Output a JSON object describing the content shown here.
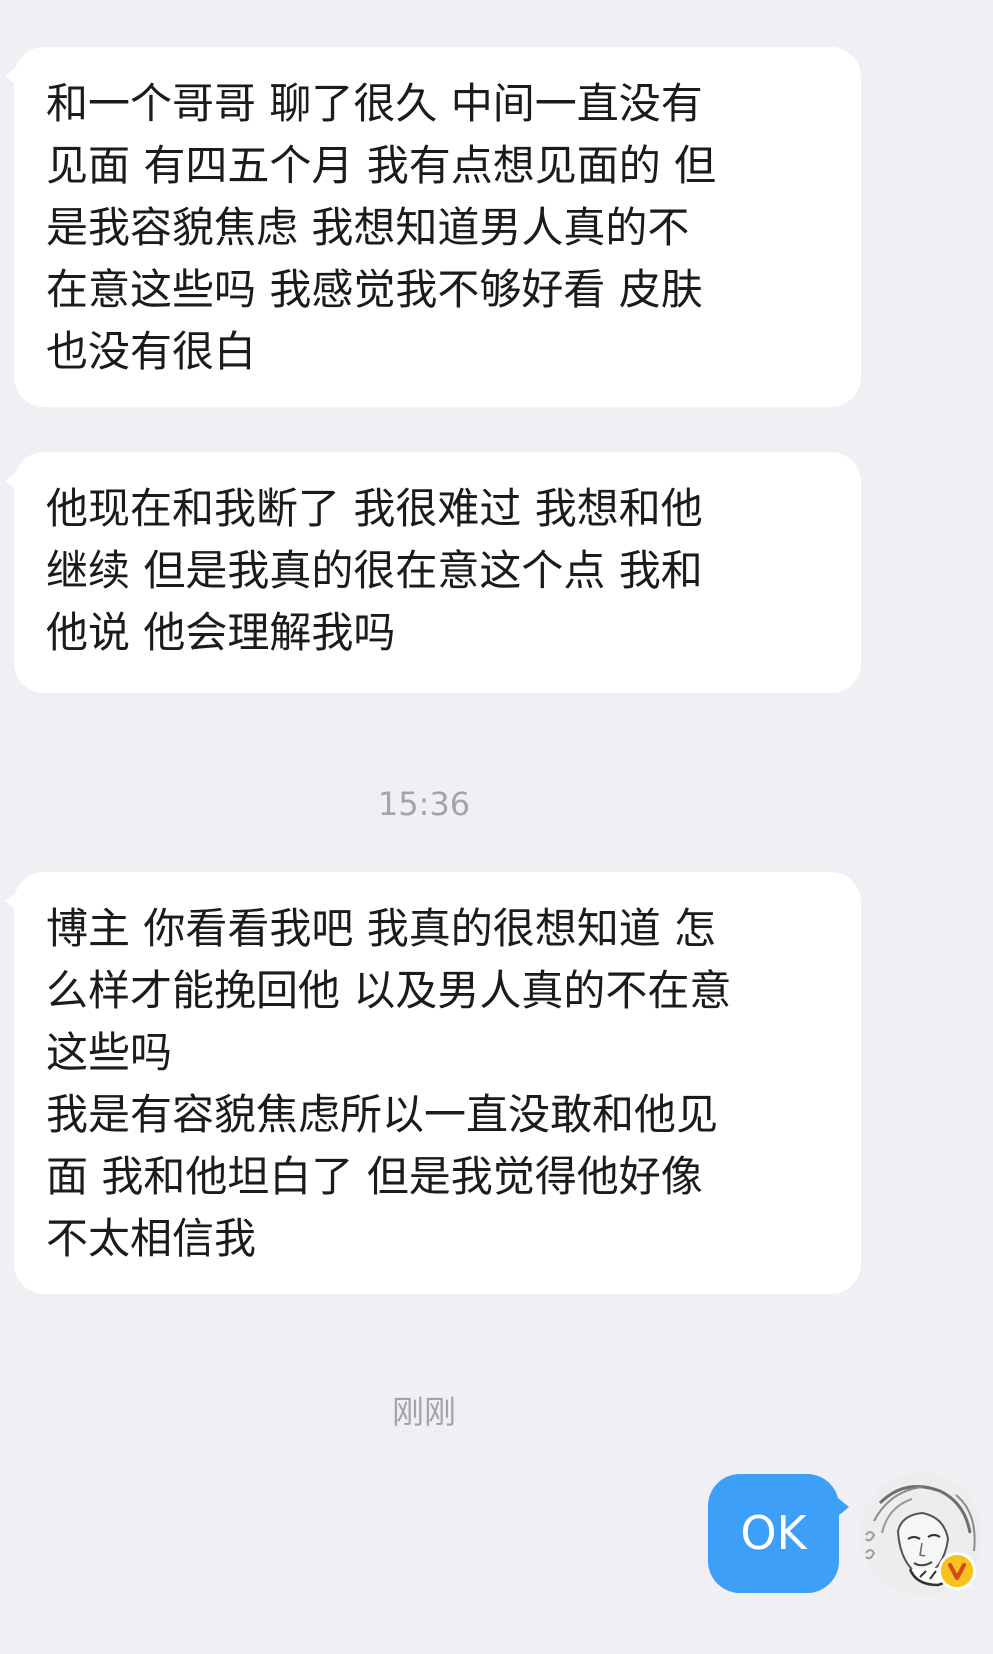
{
  "messages": [
    {
      "direction": "incoming",
      "text": "和一个哥哥 聊了很久 中间一直没有\n见面  有四五个月  我有点想见面的 但\n是我容貌焦虑  我想知道男人真的不\n在意这些吗  我感觉我不够好看  皮肤\n也没有很白"
    },
    {
      "direction": "incoming",
      "text": "他现在和我断了 我很难过 我想和他\n继续 但是我真的很在意这个点  我和\n他说 他会理解我吗"
    },
    {
      "direction": "incoming",
      "text": "博主 你看看我吧 我真的很想知道 怎\n么样才能挽回他 以及男人真的不在意\n这些吗\n我是有容貌焦虑所以一直没敢和他见\n面 我和他坦白了 但是我觉得他好像\n不太相信我"
    },
    {
      "direction": "outgoing",
      "text": "OK"
    }
  ],
  "timestamps": [
    "15:36",
    "刚刚"
  ],
  "avatar": {
    "icon": "user-avatar-sketch",
    "badge_icon": "verified-v-icon",
    "badge_color": "#f7c11f"
  },
  "colors": {
    "background": "#efeff4",
    "incoming_bubble": "#ffffff",
    "outgoing_bubble": "#3d9ff7",
    "timestamp_text": "#a3a3a8"
  }
}
